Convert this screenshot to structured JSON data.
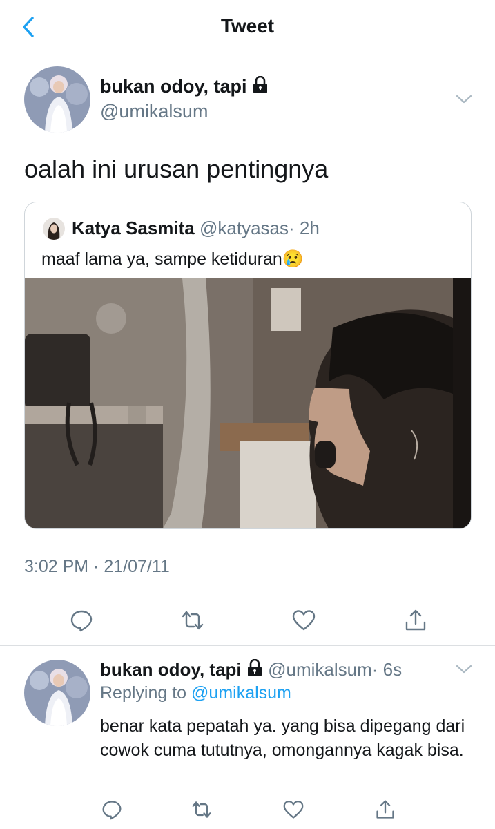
{
  "header": {
    "title": "Tweet"
  },
  "tweet": {
    "author_name": "bukan odoy, tapi",
    "author_handle": "@umikalsum",
    "text": "oalah ini urusan pentingnya",
    "timestamp": "3:02 PM · 21/07/11"
  },
  "quote": {
    "author_name": "Katya Sasmita",
    "author_handle": "@katyasas",
    "time": "· 2h",
    "text": "maaf lama ya, sampe ketiduran",
    "emoji": "😢"
  },
  "reply": {
    "author_name": "bukan odoy, tapi",
    "author_handle": "@umikalsum",
    "time": "· 6s",
    "replying_prefix": "Replying to",
    "replying_to": "@umikalsum",
    "text": "benar kata pepatah ya. yang bisa dipegang dari cowok cuma tututnya, omongannya kagak bisa."
  },
  "icons": {
    "back": "chevron-left-icon",
    "lock": "lock-icon",
    "more": "chevron-down-icon",
    "reply": "comment-icon",
    "retweet": "retweet-icon",
    "like": "heart-icon",
    "share": "share-icon"
  },
  "colors": {
    "accent": "#1da1f2",
    "text": "#14171a",
    "muted": "#657786",
    "border": "#dcdfe2"
  }
}
